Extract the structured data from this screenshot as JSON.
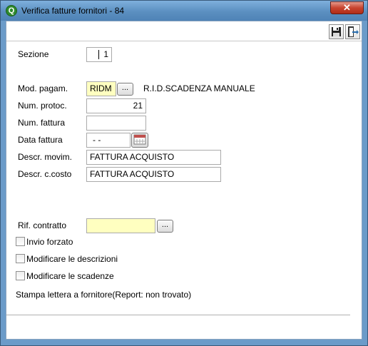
{
  "window": {
    "title": "Verifica fatture fornitori - 84",
    "app_icon_glyph": "Q",
    "close_glyph": "✕"
  },
  "toolbar": {
    "save_icon": "floppy-disk-icon",
    "exit_icon": "exit-door-icon"
  },
  "form": {
    "sezione": {
      "label": "Sezione",
      "value": "1"
    },
    "mod_pagam": {
      "label": "Mod. pagam.",
      "value": "RIDM",
      "description": "R.I.D.SCADENZA MANUALE",
      "lookup_label": "..."
    },
    "num_protoc": {
      "label": "Num. protoc.",
      "value": "21"
    },
    "num_fattura": {
      "label": "Num. fattura",
      "value": ""
    },
    "data_fattura": {
      "label": "Data fattura",
      "value": " -  -"
    },
    "descr_movim": {
      "label": "Descr. movim.",
      "value": "FATTURA ACQUISTO"
    },
    "descr_ccosto": {
      "label": "Descr. c.costo",
      "value": "FATTURA ACQUISTO"
    },
    "rif_contratto": {
      "label": "Rif. contratto",
      "value": "",
      "lookup_label": "..."
    },
    "checkboxes": [
      {
        "label": "Invio forzato",
        "checked": false
      },
      {
        "label": "Modificare le descrizioni",
        "checked": false
      },
      {
        "label": "Modificare le scadenze",
        "checked": false
      }
    ],
    "report_status": "Stampa lettera a fornitore(Report: non trovato)"
  },
  "colors": {
    "titlebar": "#5b8fc0",
    "highlight_field": "#ffffc0",
    "close_button": "#c8442f"
  }
}
